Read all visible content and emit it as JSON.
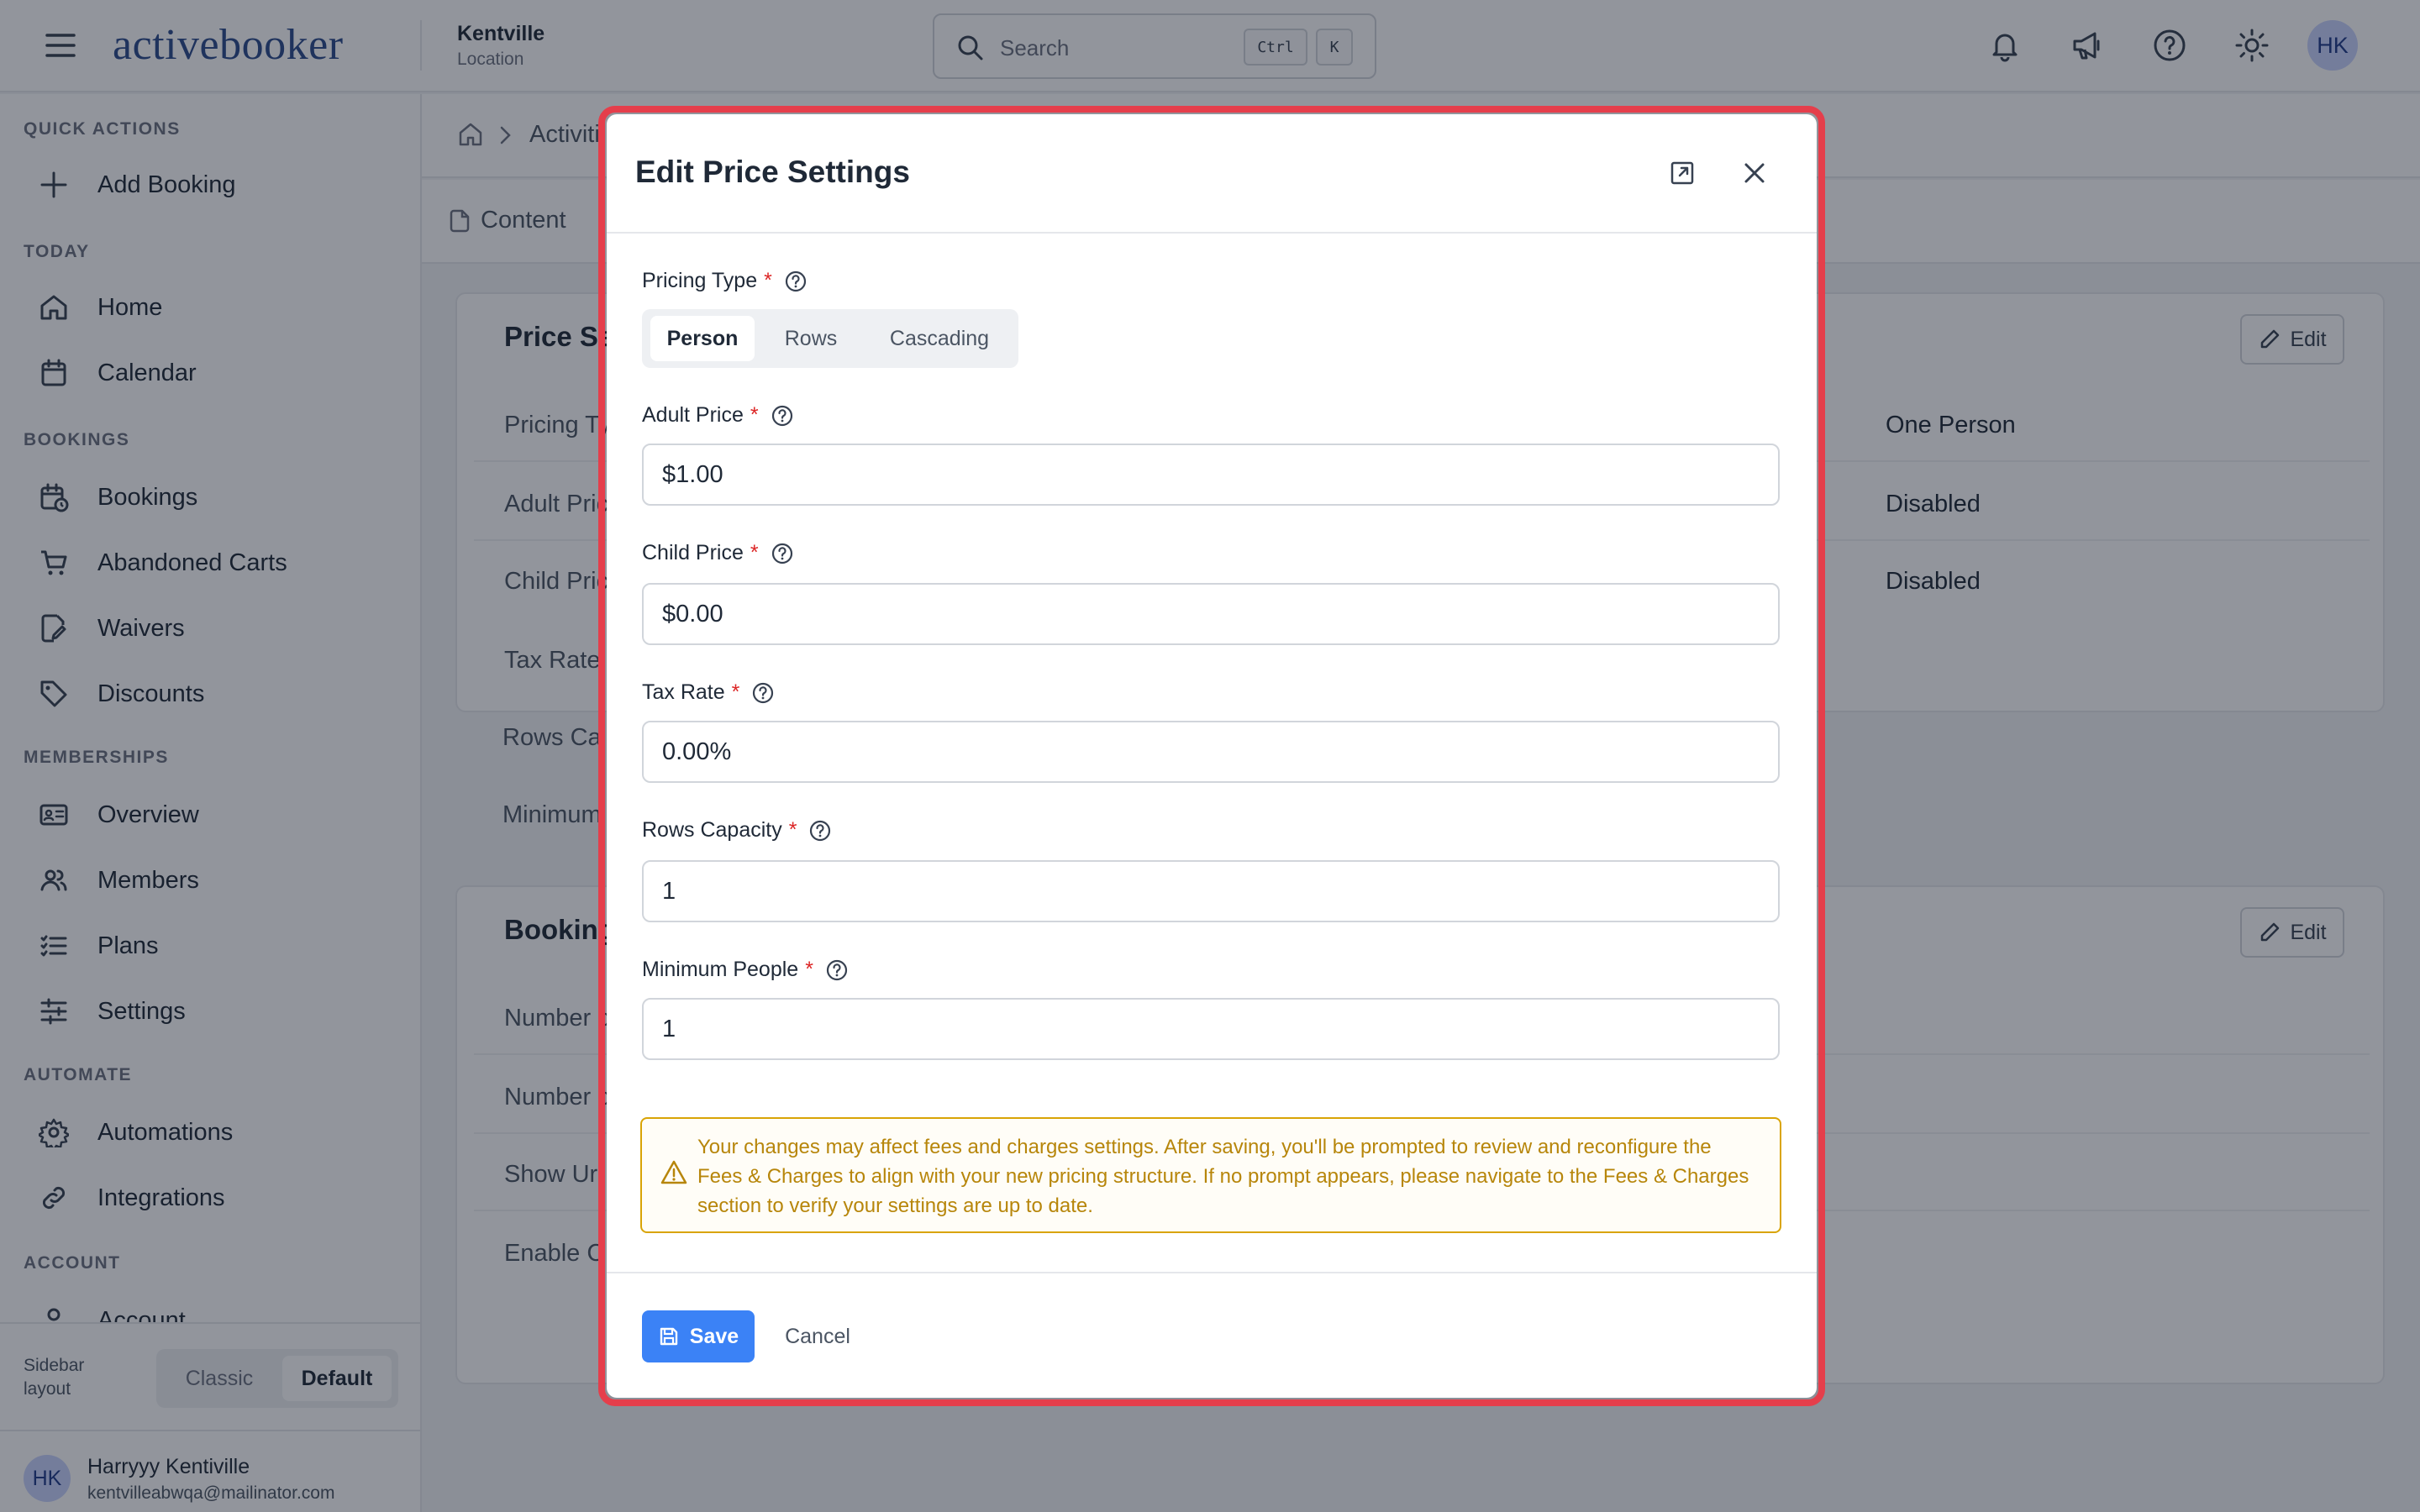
{
  "app": {
    "logo_text": "activebooker"
  },
  "header": {
    "location_name": "Kentville",
    "location_sub": "Location",
    "search_placeholder": "Search",
    "shortcut_ctrl": "Ctrl",
    "shortcut_k": "K",
    "avatar_initials": "HK",
    "icons": [
      "menu-icon",
      "bell-icon",
      "megaphone-icon",
      "help-icon",
      "sun-icon"
    ]
  },
  "sidebar": {
    "sections": [
      {
        "label": "QUICK ACTIONS",
        "items": [
          {
            "label": "Add Booking",
            "icon": "plus-icon"
          }
        ]
      },
      {
        "label": "TODAY",
        "items": [
          {
            "label": "Home",
            "icon": "home-icon"
          },
          {
            "label": "Calendar",
            "icon": "calendar-icon"
          }
        ]
      },
      {
        "label": "BOOKINGS",
        "items": [
          {
            "label": "Bookings",
            "icon": "calendar-clock-icon"
          },
          {
            "label": "Abandoned Carts",
            "icon": "cart-icon"
          },
          {
            "label": "Waivers",
            "icon": "file-signature-icon"
          },
          {
            "label": "Discounts",
            "icon": "tag-icon"
          }
        ]
      },
      {
        "label": "MEMBERSHIPS",
        "items": [
          {
            "label": "Overview",
            "icon": "id-card-icon"
          },
          {
            "label": "Members",
            "icon": "users-icon"
          },
          {
            "label": "Plans",
            "icon": "list-icon"
          },
          {
            "label": "Settings",
            "icon": "sliders-icon"
          }
        ]
      },
      {
        "label": "AUTOMATE",
        "items": [
          {
            "label": "Automations",
            "icon": "gear-icon"
          },
          {
            "label": "Integrations",
            "icon": "link-icon"
          }
        ]
      },
      {
        "label": "ACCOUNT",
        "items": [
          {
            "label": "Account",
            "icon": "user-icon"
          }
        ]
      }
    ],
    "layout_label": "Sidebar layout",
    "layout_options": [
      "Classic",
      "Default"
    ],
    "layout_selected": "Default",
    "user": {
      "initials": "HK",
      "name": "Harryyy Kentiville",
      "email": "kentvilleabwqa@mailinator.com"
    }
  },
  "main": {
    "breadcrumb": "Activiti",
    "tab": "Content",
    "card1": {
      "title": "Price Se",
      "edit_label": "Edit",
      "rows": [
        {
          "label": "Pricing Ty",
          "value": "One Person"
        },
        {
          "label": "Adult Pric",
          "value": "Disabled"
        },
        {
          "label": "Child Pric",
          "value": "Disabled"
        },
        {
          "label": "Tax Rate",
          "value": ""
        },
        {
          "label": "Rows Ca",
          "value": ""
        },
        {
          "label": "Minimum",
          "value": ""
        }
      ]
    },
    "card2": {
      "title": "Booking",
      "edit_label": "Edit",
      "rows": [
        {
          "label": "Number c"
        },
        {
          "label": "Number c"
        },
        {
          "label": "Show Ur"
        },
        {
          "label": "Enable C"
        }
      ]
    }
  },
  "modal": {
    "title": "Edit Price Settings",
    "pricing_type": {
      "label": "Pricing Type",
      "options": [
        "Person",
        "Rows",
        "Cascading"
      ],
      "selected": "Person"
    },
    "fields": [
      {
        "label": "Adult Price",
        "value": "$1.00"
      },
      {
        "label": "Child Price",
        "value": "$0.00"
      },
      {
        "label": "Tax Rate",
        "value": "0.00%"
      },
      {
        "label": "Rows Capacity",
        "value": "1"
      },
      {
        "label": "Minimum People",
        "value": "1"
      }
    ],
    "required_mark": "*",
    "alert_text": "Your changes may affect fees and charges settings. After saving, you'll be prompted to review and reconfigure the Fees & Charges to align with your new pricing structure. If no prompt appears, please navigate to the Fees & Charges section to verify your settings are up to date.",
    "save_label": "Save",
    "cancel_label": "Cancel"
  },
  "colors": {
    "accent": "#3b82f6",
    "highlight_frame": "#e53e4b",
    "warning": "#d9a406",
    "required": "#dc2626"
  }
}
